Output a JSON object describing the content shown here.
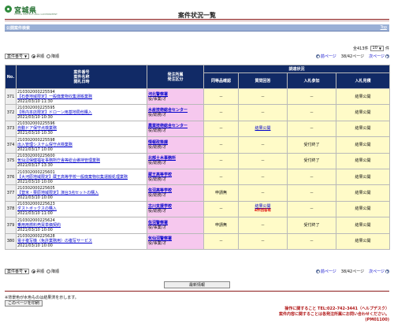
{
  "header": {
    "logo_name": "宮城県",
    "logo_sub": "MIYAGI PREFECTURAL GOVERNMENT",
    "title": "案件状況一覧"
  },
  "section": {
    "label": "公開案件検索",
    "top_link": "Top"
  },
  "count_bar": {
    "prefix": "全413件",
    "per_page": "10",
    "suffix": "件"
  },
  "toolbar": {
    "display_select": "案件番号",
    "asc_label": "昇順",
    "desc_label": "降順",
    "prev_label": "前ページ",
    "page_indicator": "38/42ページ",
    "next_label": "次ページ"
  },
  "table_headers": {
    "no": "No.",
    "case": [
      "案件番号",
      "案件名称",
      "開札日時"
    ],
    "org": [
      "発注所属",
      "発注区分"
    ],
    "survey": "調達状況",
    "sub": [
      "同等品確認",
      "質問回答",
      "入札参加",
      "入札見積"
    ]
  },
  "rows": [
    {
      "no": "371",
      "case_no": "210302000225594",
      "case_name": "【石巻地域限定】一般廃棄物収集運搬業務",
      "date": "2021/03/10 11:30",
      "org": "河北警察署",
      "kind": "役/事業/オ",
      "equiv": "－",
      "qa": "－",
      "part": "－",
      "part_note": "",
      "est": "結果公開"
    },
    {
      "no": "372",
      "case_no": "210302000225595",
      "case_name": "【県内本店限定】ドローン用基地局他購入",
      "date": "2021/03/10 10:30",
      "org": "水産技術総合センター",
      "kind": "役/総務/オ",
      "equiv": "－",
      "qa": "－",
      "part": "－",
      "part_note": "",
      "est": "結果公開"
    },
    {
      "no": "373",
      "case_no": "210302000225596",
      "case_name": "自動ドア保守点検業務",
      "date": "2021/03/10 10:30",
      "org": "農業技術総合センター",
      "kind": "役/総務/オ",
      "equiv": "－",
      "qa": "結果公開",
      "part": "－",
      "part_note": "",
      "est": "結果公開"
    },
    {
      "no": "374",
      "case_no": "210302000225598",
      "case_name": "出入管理システム保守点検業務",
      "date": "2021/03/17 10:00",
      "org": "情報政策課",
      "kind": "役/総務/オ",
      "equiv": "－",
      "qa": "－",
      "part": "受付終了",
      "part_note": "",
      "est": "結果公開"
    },
    {
      "no": "375",
      "case_no": "210302000225600",
      "case_name": "気仙沼保健福祉事務所庁舎等総合維持管理業務",
      "date": "2021/03/17 13:30",
      "org": "北部土木事務所",
      "kind": "役/総務/オ",
      "equiv": "－",
      "qa": "－",
      "part": "受付終了",
      "part_note": "",
      "est": "結果公開"
    },
    {
      "no": "376",
      "case_no": "210302000225601",
      "case_name": "【大河原地域限定】蔵王高等学校一般廃棄物収集運搬処理業務",
      "date": "2021/03/10 10:00",
      "org": "蔵王高等学校",
      "kind": "役/総務/オ",
      "equiv": "－",
      "qa": "－",
      "part": "－",
      "part_note": "",
      "est": "結果公開"
    },
    {
      "no": "377",
      "case_no": "210302000225605",
      "case_name": "【登米・栗原地域限定】演台3点セットの購入",
      "date": "2021/03/10 10:00",
      "org": "佐沼高等学校",
      "kind": "役/総務/オ",
      "equiv": "申請無",
      "qa": "－",
      "part": "－",
      "part_note": "",
      "est": "結果公開"
    },
    {
      "no": "378",
      "case_no": "210302000225623",
      "case_name": "ダストボックスの購入",
      "date": "2021/03/10 11:00",
      "org": "古川支援学校",
      "kind": "役/総務/オ",
      "equiv": "－",
      "qa": "結果公開",
      "part": "－",
      "part_note": "4件回答有",
      "est": "結果公開"
    },
    {
      "no": "379",
      "case_no": "210302000225624",
      "case_name": "乗用用燃料売買単価契約",
      "date": "2021/03/10 10:00",
      "org": "佐沼警察署",
      "kind": "役/事業/オ",
      "equiv": "申請無",
      "qa": "－",
      "part": "受付終了",
      "part_note": "",
      "est": "結果公開"
    },
    {
      "no": "380",
      "case_no": "210302000225628",
      "case_name": "電子複写機（免許業務用）の複写サービス",
      "date": "2021/03/10 10:00",
      "org": "気仙沼警察署",
      "kind": "役/事業/オ",
      "equiv": "－",
      "qa": "－",
      "part": "－",
      "part_note": "",
      "est": "結果公開"
    }
  ],
  "footer": {
    "latest_btn": "最新情報",
    "note": "※背景色が水色ものは結果済を示します。",
    "print_btn": "このページを印刷",
    "contact1": "操作に関すること TEL:022-742-3441（ヘルプデスク）",
    "contact2": "案件内容に関することは各発注所属にお問い合わせください。",
    "code": "(PM01100)"
  }
}
